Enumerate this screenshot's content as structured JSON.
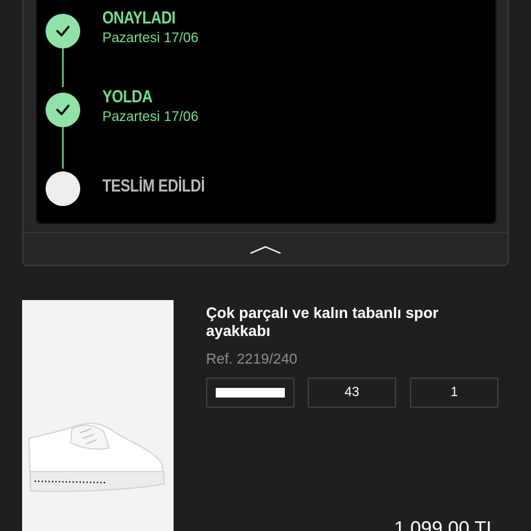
{
  "tracking": {
    "steps": [
      {
        "title": "ONAYLADI",
        "date": "Pazartesi 17/06",
        "status": "done",
        "icon": "check-icon"
      },
      {
        "title": "YOLDA",
        "date": "Pazartesi 17/06",
        "status": "done",
        "icon": "check-icon"
      },
      {
        "title": "TESLİM EDİLDİ",
        "date": "",
        "status": "pending",
        "icon": ""
      }
    ],
    "collapse_icon": "chevron-up-icon",
    "accent_color": "#6fe08d"
  },
  "product": {
    "name": "Çok parçalı ve kalın tabanlı spor ayakkabı",
    "ref": "Ref. 2219/240",
    "color_swatch": "#ffffff",
    "size": "43",
    "quantity": "1",
    "price": "1.099,00 TL"
  }
}
